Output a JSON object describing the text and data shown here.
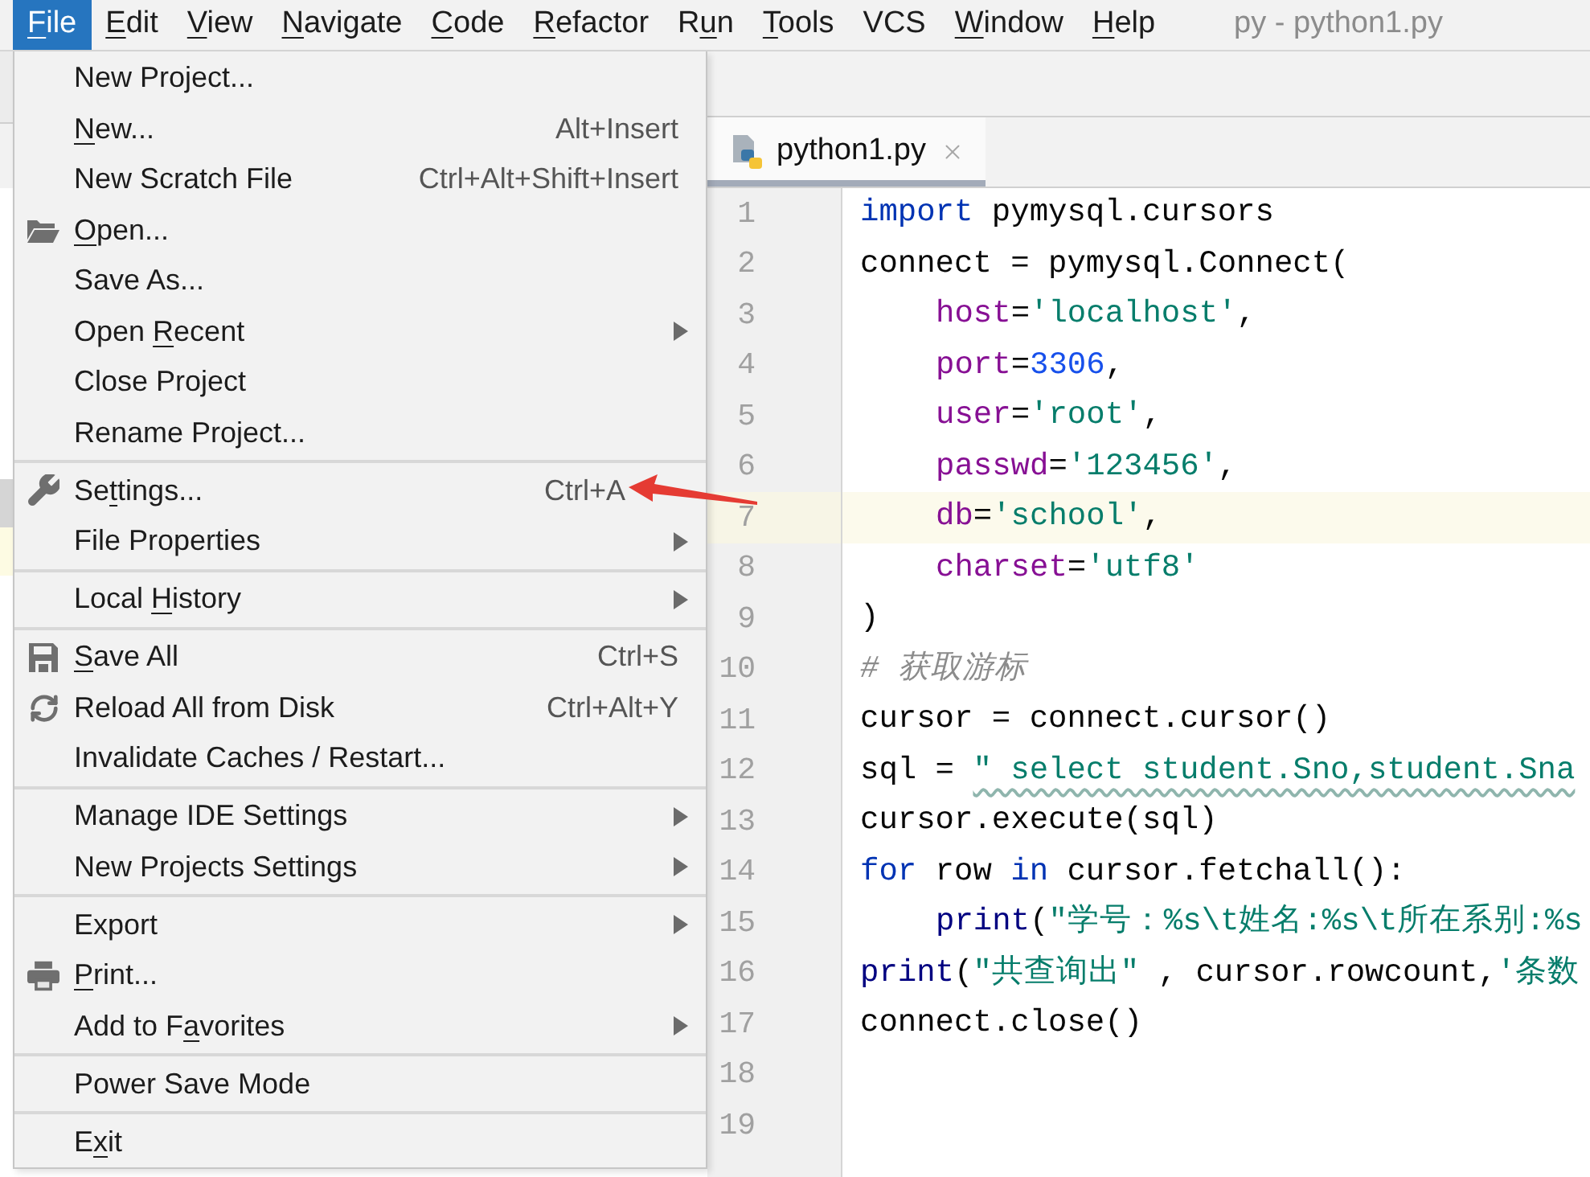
{
  "menu_bar": {
    "items": [
      {
        "mnemonic": "F",
        "after": "ile",
        "selected": true
      },
      {
        "mnemonic": "E",
        "after": "dit",
        "selected": false
      },
      {
        "mnemonic": "V",
        "after": "iew",
        "selected": false
      },
      {
        "mnemonic": "N",
        "after": "avigate",
        "selected": false
      },
      {
        "mnemonic": "C",
        "after": "ode",
        "selected": false
      },
      {
        "mnemonic": "R",
        "after": "efactor",
        "selected": false
      },
      {
        "before": "R",
        "mnemonic": "u",
        "after": "n",
        "selected": false
      },
      {
        "mnemonic": "T",
        "after": "ools",
        "selected": false
      },
      {
        "label": "VCS",
        "selected": false
      },
      {
        "mnemonic": "W",
        "after": "indow",
        "selected": false
      },
      {
        "mnemonic": "H",
        "after": "elp",
        "selected": false
      }
    ],
    "title": "py - python1.py"
  },
  "file_menu": {
    "sections": [
      [
        {
          "kind": "plain",
          "label": "New Project...",
          "submenu": false,
          "annotated": false
        },
        {
          "kind": "plain",
          "mnemonic": "N",
          "after": "ew...",
          "shortcut": "Alt+Insert",
          "submenu": false,
          "annotated": false
        },
        {
          "kind": "plain",
          "label": "New Scratch File",
          "shortcut": "Ctrl+Alt+Shift+Insert",
          "submenu": false,
          "annotated": false
        },
        {
          "kind": "folder",
          "mnemonic": "O",
          "after": "pen...",
          "submenu": false,
          "annotated": false
        },
        {
          "kind": "plain",
          "label": "Save As...",
          "submenu": false,
          "annotated": false
        },
        {
          "kind": "plain",
          "before": "Open ",
          "mnemonic": "R",
          "after": "ecent",
          "submenu": true,
          "annotated": false
        },
        {
          "kind": "plain",
          "label": "Close Project",
          "submenu": false,
          "annotated": false
        },
        {
          "kind": "plain",
          "label": "Rename Project...",
          "submenu": false,
          "annotated": false
        }
      ],
      [
        {
          "kind": "wrench",
          "before": "Se",
          "mnemonic": "t",
          "after": "tings...",
          "shortcut": "Ctrl+A",
          "submenu": false,
          "annotated": true
        },
        {
          "kind": "plain",
          "label": "File Properties",
          "submenu": true,
          "annotated": false
        }
      ],
      [
        {
          "kind": "plain",
          "before": "Local ",
          "mnemonic": "H",
          "after": "istory",
          "submenu": true,
          "annotated": false
        }
      ],
      [
        {
          "kind": "floppy",
          "mnemonic": "S",
          "after": "ave All",
          "shortcut": "Ctrl+S",
          "submenu": false,
          "annotated": false
        },
        {
          "kind": "reload",
          "label": "Reload All from Disk",
          "shortcut": "Ctrl+Alt+Y",
          "submenu": false,
          "annotated": false
        },
        {
          "kind": "plain",
          "label": "Invalidate Caches / Restart...",
          "submenu": false,
          "annotated": false
        }
      ],
      [
        {
          "kind": "plain",
          "label": "Manage IDE Settings",
          "submenu": true,
          "annotated": false
        },
        {
          "kind": "plain",
          "label": "New Projects Settings",
          "submenu": true,
          "annotated": false
        }
      ],
      [
        {
          "kind": "plain",
          "label": "Export",
          "submenu": true,
          "annotated": false
        },
        {
          "kind": "printer",
          "mnemonic": "P",
          "after": "rint...",
          "submenu": false,
          "annotated": false
        },
        {
          "kind": "plain",
          "before": "Add to F",
          "mnemonic": "a",
          "after": "vorites",
          "submenu": true,
          "annotated": false
        }
      ],
      [
        {
          "kind": "plain",
          "label": "Power Save Mode",
          "submenu": false,
          "annotated": false
        }
      ],
      [
        {
          "kind": "plain",
          "before": "E",
          "mnemonic": "x",
          "after": "it",
          "submenu": false,
          "annotated": false
        }
      ]
    ]
  },
  "editor": {
    "tabs": [
      {
        "label": "python1.py",
        "selected": true
      }
    ],
    "lines": [
      {
        "number": "1",
        "indent": false,
        "current": false,
        "tokens": [
          {
            "kind": "keyword",
            "text": "import"
          },
          {
            "kind": "plain",
            "text": " pymysql.cursors"
          }
        ]
      },
      {
        "number": "2",
        "indent": false,
        "current": false,
        "tokens": [
          {
            "kind": "plain",
            "text": "connect = pymysql.Connect("
          }
        ]
      },
      {
        "number": "3",
        "indent": true,
        "current": false,
        "tokens": [
          {
            "kind": "param",
            "text": "host"
          },
          {
            "kind": "plain",
            "text": "="
          },
          {
            "kind": "string",
            "text": "'localhost'"
          },
          {
            "kind": "plain",
            "text": ","
          }
        ]
      },
      {
        "number": "4",
        "indent": true,
        "current": false,
        "tokens": [
          {
            "kind": "param",
            "text": "port"
          },
          {
            "kind": "plain",
            "text": "="
          },
          {
            "kind": "number",
            "text": "3306"
          },
          {
            "kind": "plain",
            "text": ","
          }
        ]
      },
      {
        "number": "5",
        "indent": true,
        "current": false,
        "tokens": [
          {
            "kind": "param",
            "text": "user"
          },
          {
            "kind": "plain",
            "text": "="
          },
          {
            "kind": "string",
            "text": "'root'"
          },
          {
            "kind": "plain",
            "text": ","
          }
        ]
      },
      {
        "number": "6",
        "indent": true,
        "current": false,
        "tokens": [
          {
            "kind": "param",
            "text": "passwd"
          },
          {
            "kind": "plain",
            "text": "="
          },
          {
            "kind": "string",
            "text": "'123456'"
          },
          {
            "kind": "plain",
            "text": ","
          }
        ]
      },
      {
        "number": "7",
        "indent": true,
        "current": true,
        "tokens": [
          {
            "kind": "param",
            "text": "db"
          },
          {
            "kind": "plain",
            "text": "="
          },
          {
            "kind": "string",
            "text": "'school'"
          },
          {
            "kind": "plain",
            "text": ","
          }
        ]
      },
      {
        "number": "8",
        "indent": true,
        "current": false,
        "tokens": [
          {
            "kind": "param",
            "text": "charset"
          },
          {
            "kind": "plain",
            "text": "="
          },
          {
            "kind": "string",
            "text": "'utf8'"
          }
        ]
      },
      {
        "number": "9",
        "indent": false,
        "current": false,
        "tokens": [
          {
            "kind": "plain",
            "text": ")"
          }
        ]
      },
      {
        "number": "10",
        "indent": false,
        "current": false,
        "tokens": [
          {
            "kind": "comment",
            "text": "# 获取游标"
          }
        ]
      },
      {
        "number": "11",
        "indent": false,
        "current": false,
        "tokens": [
          {
            "kind": "plain",
            "text": "cursor = connect.cursor()"
          }
        ]
      },
      {
        "number": "12",
        "indent": false,
        "current": false,
        "tokens": [
          {
            "kind": "plain",
            "text": "sql = "
          },
          {
            "kind": "string",
            "text": "\" select student.Sno,student.Sna",
            "warned": true
          }
        ]
      },
      {
        "number": "13",
        "indent": false,
        "current": false,
        "tokens": [
          {
            "kind": "plain",
            "text": "cursor.execute(sql)"
          }
        ]
      },
      {
        "number": "14",
        "indent": false,
        "current": false,
        "tokens": [
          {
            "kind": "keyword",
            "text": "for"
          },
          {
            "kind": "plain",
            "text": " row "
          },
          {
            "kind": "keyword",
            "text": "in"
          },
          {
            "kind": "plain",
            "text": " cursor.fetchall():"
          }
        ]
      },
      {
        "number": "15",
        "indent": true,
        "current": false,
        "tokens": [
          {
            "kind": "builtin",
            "text": "print"
          },
          {
            "kind": "plain",
            "text": "("
          },
          {
            "kind": "string",
            "text": "\"学号：%s\\t姓名:%s\\t所在系别:%s"
          }
        ]
      },
      {
        "number": "16",
        "indent": false,
        "current": false,
        "tokens": [
          {
            "kind": "builtin",
            "text": "print"
          },
          {
            "kind": "plain",
            "text": "("
          },
          {
            "kind": "string",
            "text": "\"共查询出\""
          },
          {
            "kind": "plain",
            "text": " , cursor.rowcount,"
          },
          {
            "kind": "string",
            "text": "'条数"
          }
        ]
      },
      {
        "number": "17",
        "indent": false,
        "current": false,
        "tokens": [
          {
            "kind": "plain",
            "text": "connect.close()"
          }
        ]
      },
      {
        "number": "18",
        "current": false
      },
      {
        "number": "19",
        "current": false
      }
    ]
  }
}
